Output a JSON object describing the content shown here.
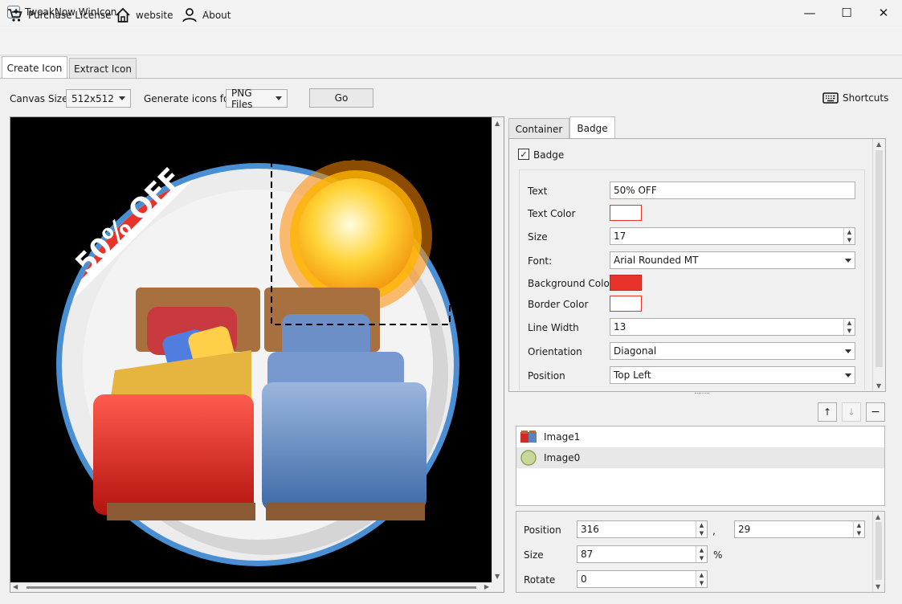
{
  "window": {
    "title": "TweakNow WinIcon",
    "minimize": "—",
    "maximize": "☐",
    "close": "✕"
  },
  "menu": {
    "purchase": "Purchase License",
    "website": "website",
    "about": "About"
  },
  "main_tabs": {
    "create": "Create Icon",
    "extract": "Extract Icon"
  },
  "toolbar": {
    "canvas_size_label": "Canvas Size:",
    "canvas_size_value": "512x512",
    "generate_label": "Generate icons for",
    "generate_value": "PNG Files",
    "go_label": "Go",
    "shortcuts_label": "Shortcuts"
  },
  "canvas": {
    "badge_text": "50% OFF",
    "badge_color": "#e8332a",
    "ring_color": "#4a8fd4"
  },
  "panel_tabs": {
    "container": "Container",
    "badge": "Badge"
  },
  "badge": {
    "checkbox_label": "Badge",
    "checked": true,
    "text_label": "Text",
    "text_value": "50% OFF",
    "text_color_label": "Text Color",
    "text_color": "#ffffff",
    "size_label": "Size",
    "size_value": "17",
    "font_label": "Font:",
    "font_value": "Arial Rounded MT",
    "bg_color_label": "Background Color",
    "bg_color": "#e8332a",
    "border_color_label": "Border Color",
    "border_color": "#ffffff",
    "line_width_label": "Line Width",
    "line_width_value": "13",
    "orientation_label": "Orientation",
    "orientation_value": "Diagonal",
    "position_label": "Position",
    "position_value": "Top Left"
  },
  "layers": [
    {
      "name": "Image1"
    },
    {
      "name": "Image0"
    }
  ],
  "transform": {
    "position_label": "Position",
    "x": "316",
    "comma": ",",
    "y": "29",
    "size_label": "Size",
    "size_value": "87",
    "size_unit": "%",
    "rotate_label": "Rotate",
    "rotate_value": "0"
  }
}
